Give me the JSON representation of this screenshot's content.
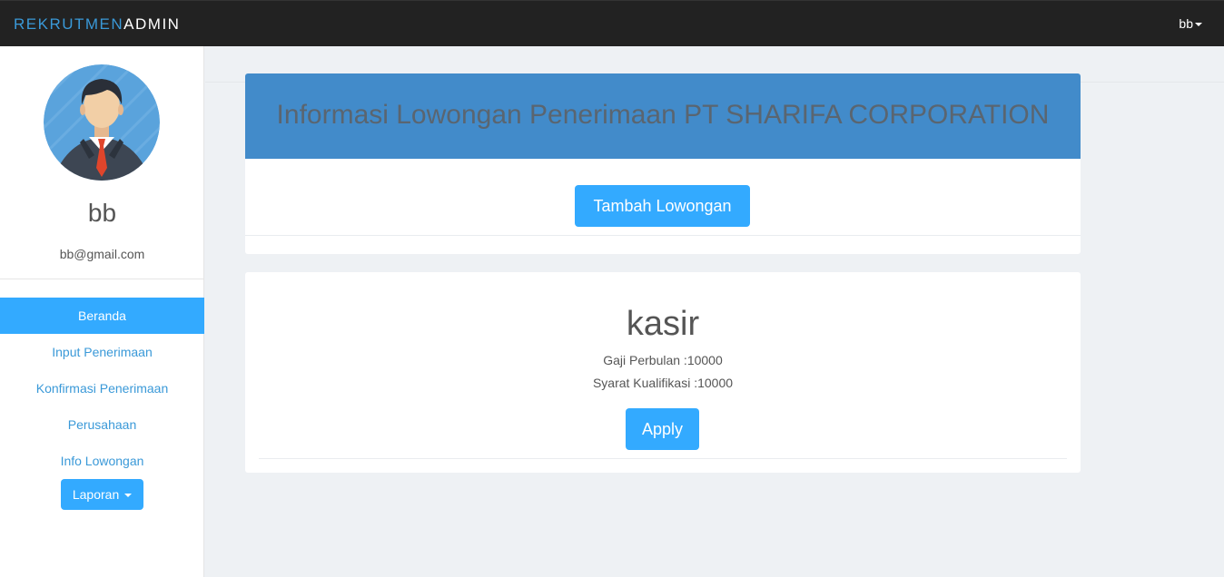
{
  "navbar": {
    "brand_part1": "REKRUTMEN",
    "brand_part2": "ADMIN",
    "user_label": "bb"
  },
  "sidebar": {
    "profile_name": "bb",
    "profile_email": "bb@gmail.com",
    "items": [
      {
        "label": "Beranda",
        "active": true
      },
      {
        "label": "Input Penerimaan",
        "active": false
      },
      {
        "label": "Konfirmasi Penerimaan",
        "active": false
      },
      {
        "label": "Perusahaan",
        "active": false
      },
      {
        "label": "Info Lowongan",
        "active": false
      }
    ],
    "dropdown_label": "Laporan"
  },
  "main": {
    "header_title": "Informasi Lowongan Penerimaan PT SHARIFA CORPORATION",
    "add_button_label": "Tambah Lowongan",
    "job": {
      "title": "kasir",
      "salary_line": "Gaji Perbulan :10000",
      "requirements_line": "Syarat Kualifikasi :10000",
      "apply_label": "Apply"
    }
  },
  "colors": {
    "navbar_bg": "#222222",
    "brand_accent": "#3a99d8",
    "primary_button": "#33aaff",
    "header_panel": "#428bca",
    "page_bg": "#eef1f4"
  },
  "icons": [
    "user-avatar",
    "caret-down-icon"
  ]
}
